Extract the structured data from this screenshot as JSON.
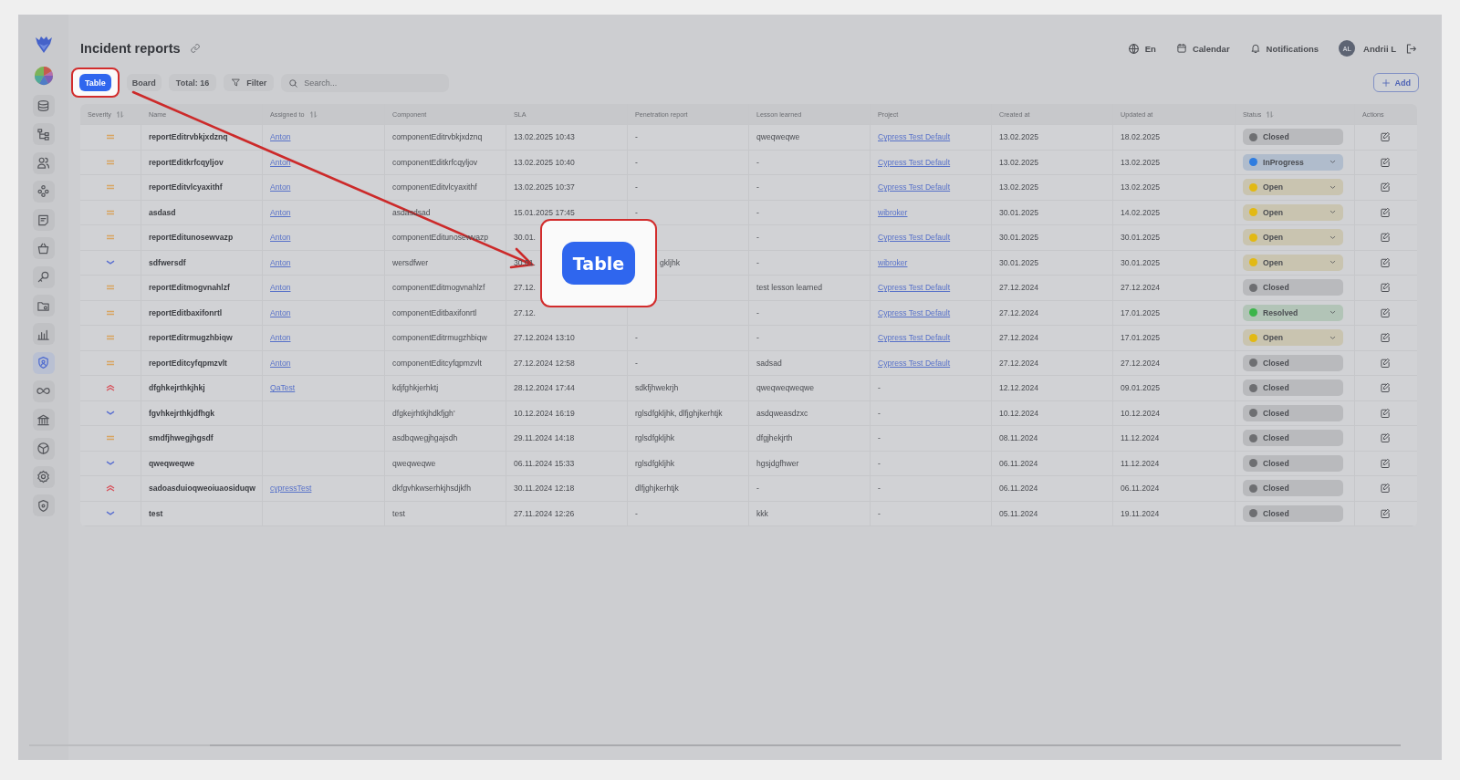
{
  "sidebar": {
    "items": [
      {
        "selected": false
      },
      {
        "selected": false
      },
      {
        "selected": false
      },
      {
        "selected": false
      },
      {
        "selected": false
      },
      {
        "selected": false
      },
      {
        "selected": false
      },
      {
        "selected": false
      },
      {
        "selected": false
      },
      {
        "selected": true
      },
      {
        "selected": false
      },
      {
        "selected": false
      },
      {
        "selected": false
      },
      {
        "selected": false
      },
      {
        "selected": false
      }
    ]
  },
  "header": {
    "title": "Incident reports",
    "language": "En",
    "calendar": "Calendar",
    "notifications": "Notifications",
    "avatar_initials": "AL",
    "user_name": "Andrii L"
  },
  "toolbar": {
    "tabs": [
      {
        "label": "Table",
        "selected": true,
        "highlighted": true
      },
      {
        "label": "Board",
        "selected": false,
        "highlighted": false
      }
    ],
    "total": "Total: 16",
    "filter": "Filter",
    "search": {
      "placeholder": "Search..."
    },
    "add_button": "Add"
  },
  "table": {
    "columns": [
      {
        "label": "Severity",
        "sortable": true
      },
      {
        "label": "Name",
        "sortable": false
      },
      {
        "label": "Assigned to",
        "sortable": true
      },
      {
        "label": "Component",
        "sortable": false
      },
      {
        "label": "SLA",
        "sortable": false
      },
      {
        "label": "Penetration report",
        "sortable": false
      },
      {
        "label": "Lesson learned",
        "sortable": false
      },
      {
        "label": "Project",
        "sortable": false
      },
      {
        "label": "Created at",
        "sortable": false
      },
      {
        "label": "Updated at",
        "sortable": false
      },
      {
        "label": "Status",
        "sortable": true
      },
      {
        "label": "Actions",
        "sortable": false
      }
    ],
    "rows": [
      {
        "kind": "medium",
        "name": "reportEditrvbkjxdznq",
        "assigned": "Anton",
        "component": "componentEditrvbkjxdznq",
        "sla": "13.02.2025 10:43",
        "penetration": "-",
        "lesson": "qweqweqwe",
        "project": {
          "text": "Cypress Test Default",
          "link": true
        },
        "created": "13.02.2025",
        "updated": "18.02.2025",
        "status": {
          "label": "Closed",
          "color": "#6e6f72",
          "dropdown": false
        }
      },
      {
        "kind": "medium",
        "name": "reportEditkrfcqyljov",
        "assigned": "Anton",
        "component": "componentEditkrfcqyljov",
        "sla": "13.02.2025 10:40",
        "penetration": "-",
        "lesson": "-",
        "project": {
          "text": "Cypress Test Default",
          "link": true
        },
        "created": "13.02.2025",
        "updated": "13.02.2025",
        "status": {
          "label": "InProgress",
          "color": "#2f7de0",
          "dropdown": true
        }
      },
      {
        "kind": "medium",
        "name": "reportEditvlcyaxithf",
        "assigned": "Anton",
        "component": "componentEditvlcyaxithf",
        "sla": "13.02.2025 10:37",
        "penetration": "-",
        "lesson": "-",
        "project": {
          "text": "Cypress Test Default",
          "link": true
        },
        "created": "13.02.2025",
        "updated": "13.02.2025",
        "status": {
          "label": "Open",
          "color": "#e2b914",
          "dropdown": true
        }
      },
      {
        "kind": "medium",
        "name": "asdasd",
        "assigned": "Anton",
        "component": "asdasdsad",
        "sla": "15.01.2025 17:45",
        "penetration": "-",
        "lesson": "-",
        "project": {
          "text": "wibroker",
          "link": true
        },
        "created": "30.01.2025",
        "updated": "14.02.2025",
        "status": {
          "label": "Open",
          "color": "#e2b914",
          "dropdown": true
        }
      },
      {
        "kind": "medium",
        "name": "reportEditunosewvazp",
        "assigned": "Anton",
        "component": "componentEditunosewvazp",
        "sla": "30.01.",
        "lesson": "-",
        "project": {
          "text": "Cypress Test Default",
          "link": true
        },
        "created": "30.01.2025",
        "updated": "30.01.2025",
        "status": {
          "label": "Open",
          "color": "#e2b914",
          "dropdown": true
        }
      },
      {
        "kind": "low",
        "name": "sdfwersdf",
        "assigned": "Anton",
        "component": "wersdfwer",
        "sla": "30.01.",
        "penetration": "gkljhk",
        "lesson": "-",
        "project": {
          "text": "wibroker",
          "link": true
        },
        "created": "30.01.2025",
        "updated": "30.01.2025",
        "status": {
          "label": "Open",
          "color": "#e2b914",
          "dropdown": true
        }
      },
      {
        "kind": "medium",
        "name": "reportEditmogvnahlzf",
        "assigned": "Anton",
        "component": "componentEditmogvnahlzf",
        "sla": "27.12.",
        "lesson": "test lesson learned",
        "project": {
          "text": "Cypress Test Default",
          "link": true
        },
        "created": "27.12.2024",
        "updated": "27.12.2024",
        "status": {
          "label": "Closed",
          "color": "#6e6f72",
          "dropdown": false
        }
      },
      {
        "kind": "medium",
        "name": "reportEditbaxifonrtl",
        "assigned": "Anton",
        "component": "componentEditbaxifonrtl",
        "sla": "27.12.",
        "lesson": "-",
        "project": {
          "text": "Cypress Test Default",
          "link": true
        },
        "created": "27.12.2024",
        "updated": "17.01.2025",
        "status": {
          "label": "Resolved",
          "color": "#3bb54a",
          "dropdown": true
        }
      },
      {
        "kind": "medium",
        "name": "reportEditrmugzhbiqw",
        "assigned": "Anton",
        "component": "componentEditrmugzhbiqw",
        "sla": "27.12.2024 13:10",
        "penetration": "-",
        "lesson": "-",
        "project": {
          "text": "Cypress Test Default",
          "link": true
        },
        "created": "27.12.2024",
        "updated": "17.01.2025",
        "status": {
          "label": "Open",
          "color": "#e2b914",
          "dropdown": true
        }
      },
      {
        "kind": "medium",
        "name": "reportEditcyfqpmzvlt",
        "assigned": "Anton",
        "component": "componentEditcyfqpmzvlt",
        "sla": "27.12.2024 12:58",
        "penetration": "-",
        "lesson": "sadsad",
        "project": {
          "text": "Cypress Test Default",
          "link": true
        },
        "created": "27.12.2024",
        "updated": "27.12.2024",
        "status": {
          "label": "Closed",
          "color": "#6e6f72",
          "dropdown": false
        }
      },
      {
        "kind": "high",
        "name": "dfghkejrthkjhkj",
        "assigned": "QaTest",
        "component": "kdjfghkjerhktj",
        "sla": "28.12.2024 17:44",
        "penetration": "sdkfjhwekrjh",
        "lesson": "qweqweqweqwe",
        "project": {
          "text": "-",
          "link": false
        },
        "created": "12.12.2024",
        "updated": "09.01.2025",
        "status": {
          "label": "Closed",
          "color": "#6e6f72",
          "dropdown": false
        }
      },
      {
        "kind": "low",
        "name": "fgvhkejrthkjdfhgk",
        "component": "dfgkejrhtkjhdkfjgh'",
        "sla": "10.12.2024 16:19",
        "penetration": "rglsdfgkljhk, dlfjghjkerhtjk",
        "lesson": "asdqweasdzxc",
        "project": {
          "text": "-",
          "link": false
        },
        "created": "10.12.2024",
        "updated": "10.12.2024",
        "status": {
          "label": "Closed",
          "color": "#6e6f72",
          "dropdown": false
        }
      },
      {
        "kind": "medium",
        "name": "smdfjhwegjhgsdf",
        "component": "asdbqwegjhgajsdh",
        "sla": "29.11.2024 14:18",
        "penetration": "rglsdfgkljhk",
        "lesson": "dfgjhekjrth",
        "project": {
          "text": "-",
          "link": false
        },
        "created": "08.11.2024",
        "updated": "11.12.2024",
        "status": {
          "label": "Closed",
          "color": "#6e6f72",
          "dropdown": false
        }
      },
      {
        "kind": "low",
        "name": "qweqweqwe",
        "component": "qweqweqwe",
        "sla": "06.11.2024 15:33",
        "penetration": "rglsdfgkljhk",
        "lesson": "hgsjdgfhwer",
        "project": {
          "text": "-",
          "link": false
        },
        "created": "06.11.2024",
        "updated": "11.12.2024",
        "status": {
          "label": "Closed",
          "color": "#6e6f72",
          "dropdown": false
        }
      },
      {
        "kind": "high",
        "name": "sadoasduioqweoiuaosiduqw",
        "assigned": "cypressTest",
        "component": "dkfgvhkwserhkjhsdjkfh",
        "sla": "30.11.2024 12:18",
        "penetration": "dlfjghjkerhtjk",
        "lesson": "-",
        "project": {
          "text": "-",
          "link": false
        },
        "created": "06.11.2024",
        "updated": "06.11.2024",
        "status": {
          "label": "Closed",
          "color": "#6e6f72",
          "dropdown": false
        }
      },
      {
        "kind": "low",
        "name": "test",
        "component": "test",
        "sla": "27.11.2024 12:26",
        "penetration": "-",
        "lesson": "kkk",
        "project": {
          "text": "-",
          "link": false
        },
        "created": "05.11.2024",
        "updated": "19.11.2024",
        "status": {
          "label": "Closed",
          "color": "#6e6f72",
          "dropdown": false
        }
      }
    ]
  },
  "callout": {
    "label": "Table"
  }
}
